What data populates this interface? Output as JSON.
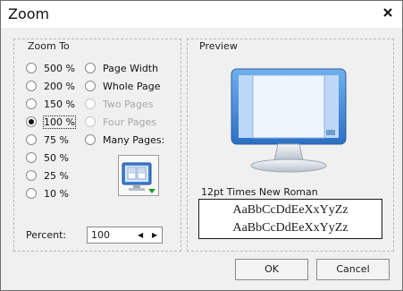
{
  "window": {
    "title": "Zoom"
  },
  "zoom_to": {
    "group_title": "Zoom To",
    "left_options": [
      {
        "label": "500 %",
        "checked": false
      },
      {
        "label": "200 %",
        "checked": false
      },
      {
        "label": "150 %",
        "checked": false
      },
      {
        "label": "100 %",
        "checked": true
      },
      {
        "label": "75 %",
        "checked": false
      },
      {
        "label": "50 %",
        "checked": false
      },
      {
        "label": "25 %",
        "checked": false
      },
      {
        "label": "10 %",
        "checked": false
      }
    ],
    "right_options": [
      {
        "label": "Page Width",
        "enabled": true
      },
      {
        "label": "Whole Page",
        "enabled": true
      },
      {
        "label": "Two Pages",
        "enabled": false
      },
      {
        "label": "Four Pages",
        "enabled": false
      },
      {
        "label": "Many Pages:",
        "enabled": true
      }
    ],
    "percent_label": "Percent:",
    "percent_value": "100"
  },
  "preview": {
    "group_title": "Preview",
    "font_label": "12pt Times New Roman",
    "sample_line1": "AaBbCcDdEeXxYyZz",
    "sample_line2": "AaBbCcDdEeXxYyZz"
  },
  "buttons": {
    "ok": "OK",
    "cancel": "Cancel"
  },
  "icons": {
    "close": "close-icon",
    "many_pages": "many-pages-icon",
    "monitor": "monitor-icon"
  }
}
